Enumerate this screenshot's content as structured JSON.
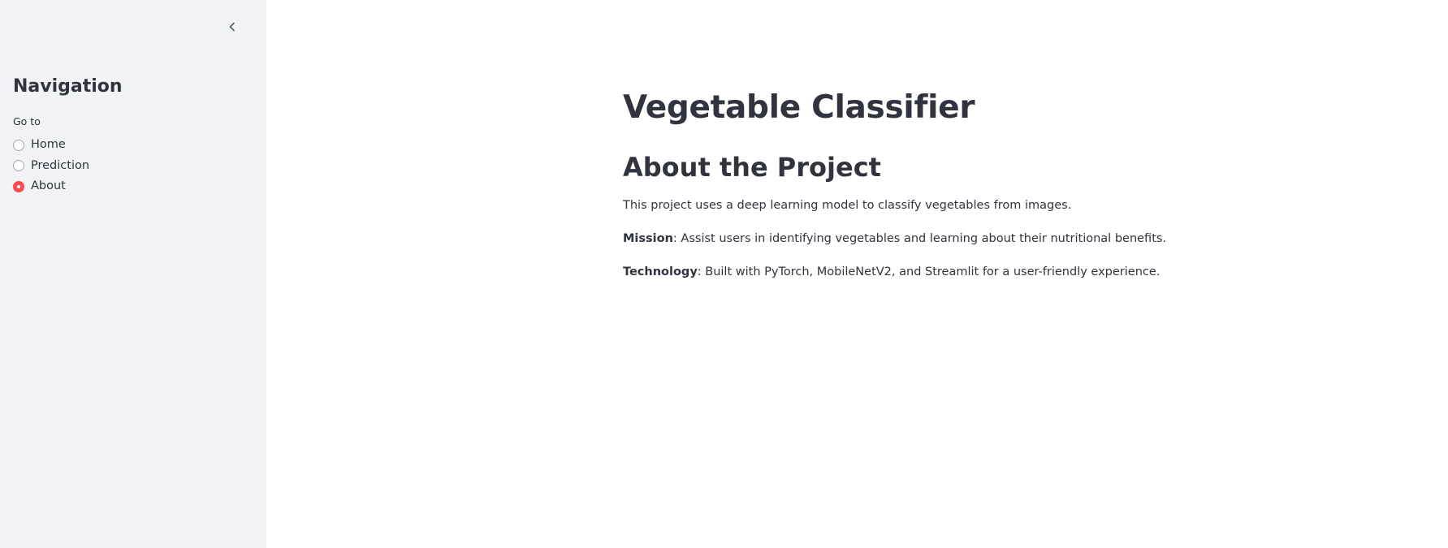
{
  "sidebar": {
    "collapse_icon": "chevron-left-icon",
    "title": "Navigation",
    "radio_label": "Go to",
    "options": [
      {
        "label": "Home",
        "selected": false
      },
      {
        "label": "Prediction",
        "selected": false
      },
      {
        "label": "About",
        "selected": true
      }
    ]
  },
  "main": {
    "title": "Vegetable Classifier",
    "subtitle": "About the Project",
    "intro": "This project uses a deep learning model to classify vegetables from images.",
    "mission_label": "Mission",
    "mission_text": ": Assist users in identifying vegetables and learning about their nutritional benefits.",
    "technology_label": "Technology",
    "technology_text": ": Built with PyTorch, MobileNetV2, and Streamlit for a user-friendly experience."
  },
  "colors": {
    "sidebar_bg": "#f0f2f6",
    "accent": "#ff4b4b",
    "text": "#31333f"
  }
}
